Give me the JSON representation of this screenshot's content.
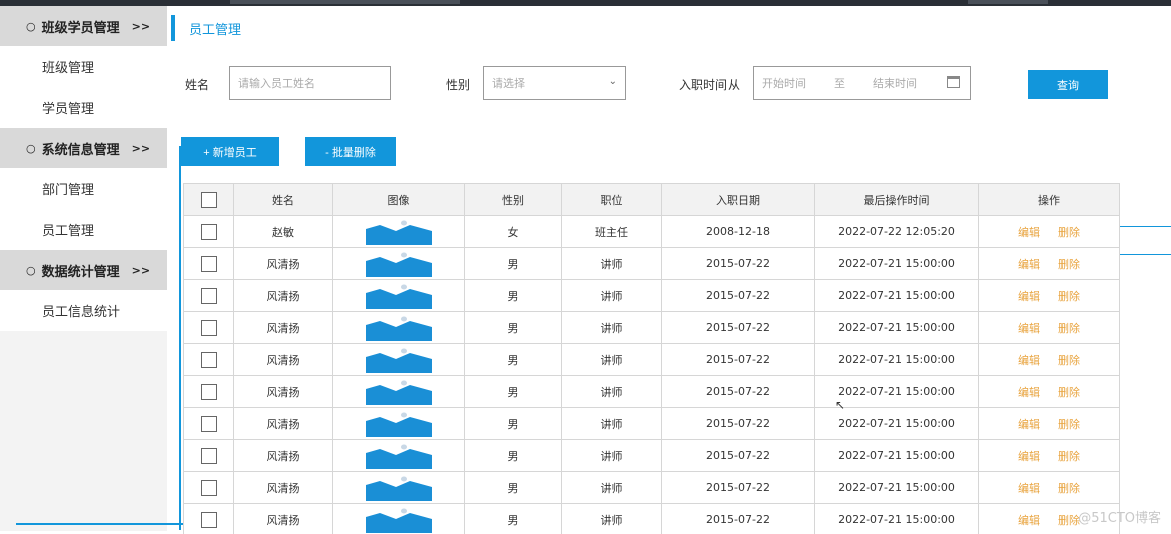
{
  "sidebar": {
    "groups": [
      {
        "label": "班级学员管理",
        "arrow": ">>",
        "items": [
          "班级管理",
          "学员管理"
        ]
      },
      {
        "label": "系统信息管理",
        "arrow": ">>",
        "items": [
          "部门管理",
          "员工管理"
        ]
      },
      {
        "label": "数据统计管理",
        "arrow": ">>",
        "items": [
          "员工信息统计"
        ]
      }
    ],
    "bullet": "○"
  },
  "page": {
    "title": "员工管理"
  },
  "search": {
    "name_label": "姓名",
    "name_placeholder": "请输入员工姓名",
    "gender_label": "性别",
    "gender_placeholder": "请选择",
    "date_label": "入职时间",
    "date_from": "从",
    "date_start_placeholder": "开始时间",
    "date_to": "至",
    "date_end_placeholder": "结束时间",
    "query_button": "查询"
  },
  "toolbar": {
    "add_button": "+ 新增员工",
    "batch_delete_button": "- 批量删除"
  },
  "table": {
    "headers": [
      "",
      "姓名",
      "图像",
      "性别",
      "职位",
      "入职日期",
      "最后操作时间",
      "操作"
    ],
    "edit_label": "编辑",
    "delete_label": "删除",
    "rows": [
      {
        "name": "赵敏",
        "gender": "女",
        "position": "班主任",
        "join_date": "2008-12-18",
        "last_op": "2022-07-22 12:05:20"
      },
      {
        "name": "风清扬",
        "gender": "男",
        "position": "讲师",
        "join_date": "2015-07-22",
        "last_op": "2022-07-21 15:00:00"
      },
      {
        "name": "风清扬",
        "gender": "男",
        "position": "讲师",
        "join_date": "2015-07-22",
        "last_op": "2022-07-21 15:00:00"
      },
      {
        "name": "风清扬",
        "gender": "男",
        "position": "讲师",
        "join_date": "2015-07-22",
        "last_op": "2022-07-21 15:00:00"
      },
      {
        "name": "风清扬",
        "gender": "男",
        "position": "讲师",
        "join_date": "2015-07-22",
        "last_op": "2022-07-21 15:00:00"
      },
      {
        "name": "风清扬",
        "gender": "男",
        "position": "讲师",
        "join_date": "2015-07-22",
        "last_op": "2022-07-21 15:00:00"
      },
      {
        "name": "风清扬",
        "gender": "男",
        "position": "讲师",
        "join_date": "2015-07-22",
        "last_op": "2022-07-21 15:00:00"
      },
      {
        "name": "风清扬",
        "gender": "男",
        "position": "讲师",
        "join_date": "2015-07-22",
        "last_op": "2022-07-21 15:00:00"
      },
      {
        "name": "风清扬",
        "gender": "男",
        "position": "讲师",
        "join_date": "2015-07-22",
        "last_op": "2022-07-21 15:00:00"
      },
      {
        "name": "风清扬",
        "gender": "男",
        "position": "讲师",
        "join_date": "2015-07-22",
        "last_op": "2022-07-21 15:00:00"
      }
    ]
  },
  "watermark": "@51CTO博客",
  "colors": {
    "accent": "#1296db",
    "action": "#e8a33d",
    "sidebar_group_bg": "#d9d9d9"
  },
  "icons": {
    "gender_select": "chevron-down-icon",
    "date_picker": "calendar-icon",
    "employee_image": "image-placeholder-icon"
  }
}
